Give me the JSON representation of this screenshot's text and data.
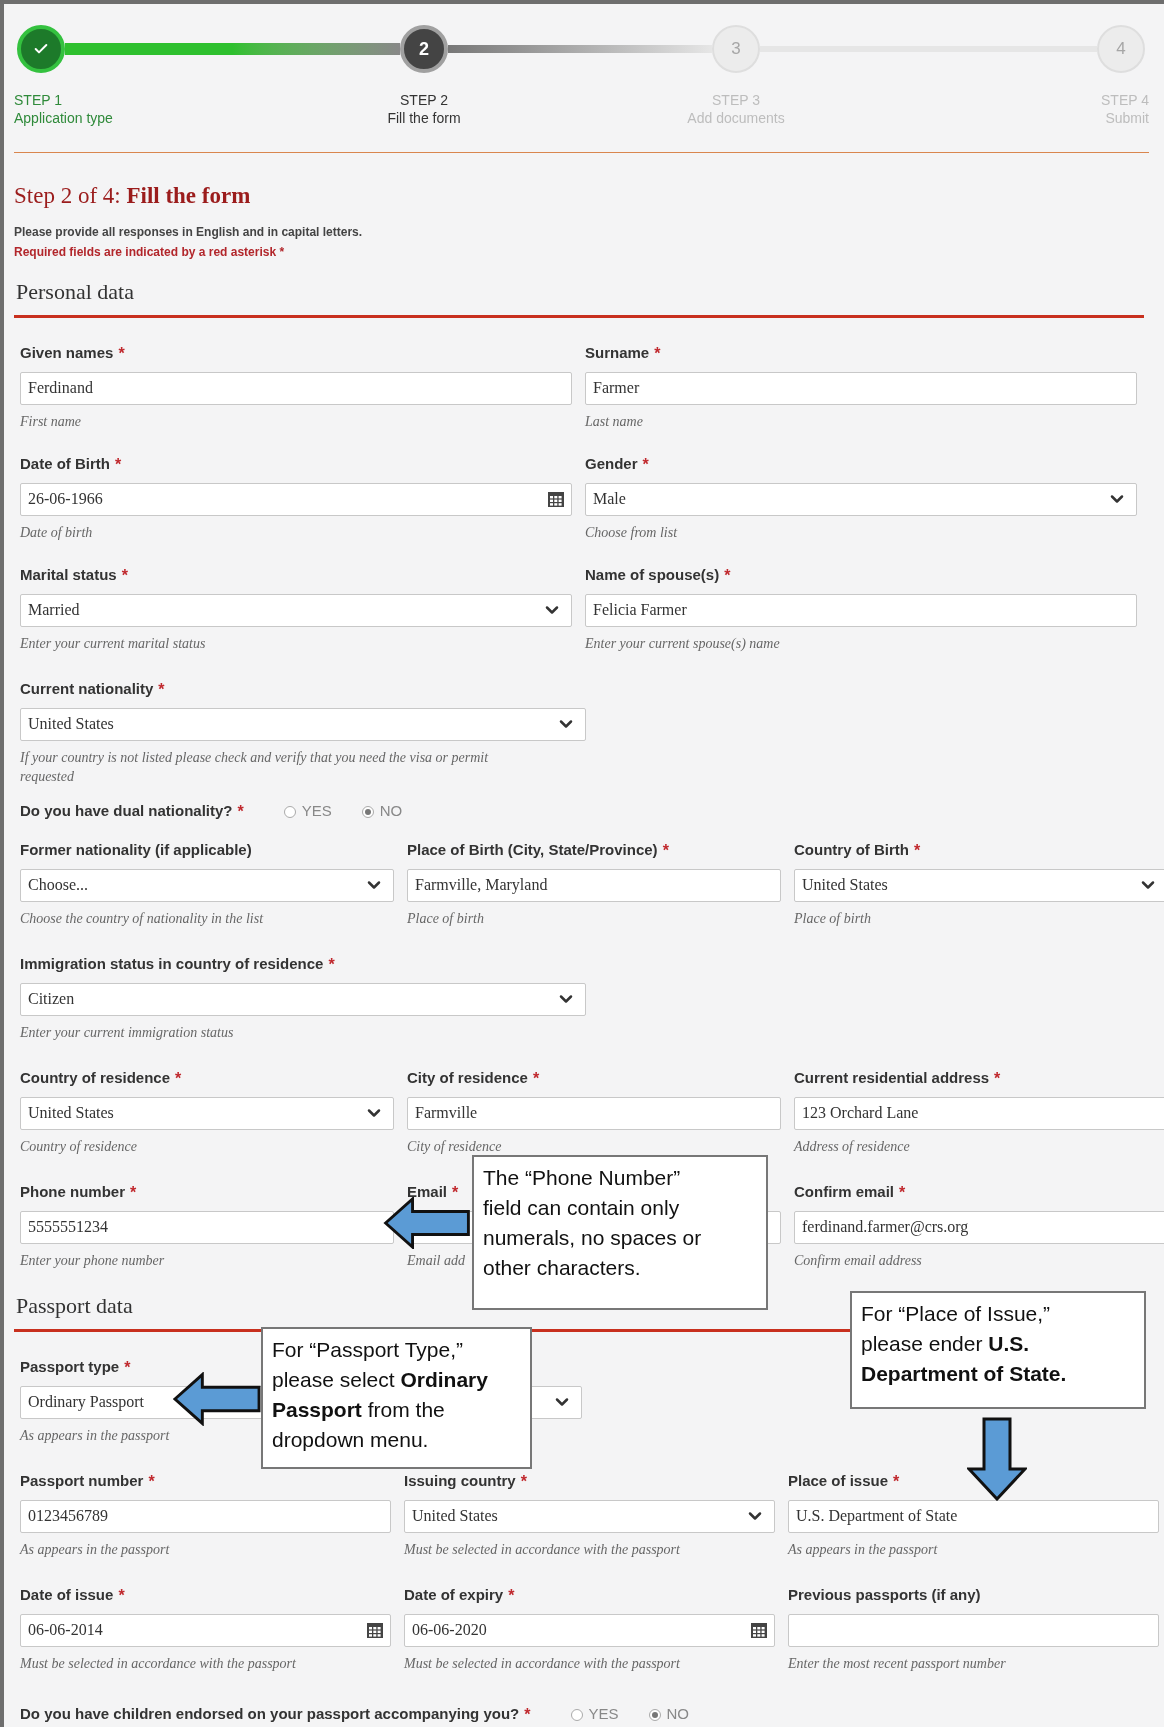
{
  "steps": [
    {
      "completed": true,
      "selected": false,
      "step": "STEP 1",
      "title": "Application type"
    },
    {
      "completed": false,
      "selected": true,
      "number": "2",
      "step": "STEP 2",
      "title": "Fill the form"
    },
    {
      "completed": false,
      "selected": false,
      "number": "3",
      "step": "STEP 3",
      "title": "Add documents"
    },
    {
      "completed": false,
      "selected": false,
      "number": "4",
      "step": "STEP 4",
      "title": "Submit"
    }
  ],
  "heading": "Step 2 of 4: **Fill the form**",
  "instructions": "Please provide all responses in English and in capital letters.",
  "required_note": "Required fields are indicated by a red asterisk *",
  "sections": [
    {
      "title": "Personal data",
      "blocks": [
        {
          "kind": "pair",
          "fields": [
            {
              "label": "Given names",
              "asterisk": "*",
              "kind": "text",
              "value": "Ferdinand",
              "hint": "First name"
            },
            {
              "label": "Surname",
              "asterisk": "*",
              "kind": "text",
              "value": "Farmer",
              "hint": "Last name"
            }
          ]
        },
        {
          "kind": "pair",
          "fields": [
            {
              "label": "Date of Birth",
              "asterisk": "*",
              "kind": "date",
              "value": "26-06-1966",
              "hint": "Date of birth"
            },
            {
              "label": "Gender",
              "asterisk": "*",
              "kind": "select",
              "value": "Male",
              "hint": "Choose from list"
            }
          ]
        },
        {
          "kind": "pair",
          "fields": [
            {
              "label": "Marital status",
              "asterisk": "*",
              "kind": "select",
              "value": "Married",
              "hint": "Enter your current marital status"
            },
            {
              "label": "Name of spouse(s)",
              "asterisk": "*",
              "kind": "text",
              "value": "Felicia Farmer",
              "hint": "Enter your current spouse(s) name"
            }
          ]
        },
        {
          "kind": "single",
          "fields": [
            {
              "label": "Current nationality",
              "asterisk": "*",
              "kind": "select",
              "value": "United States",
              "hint": "If your country is not listed please check and verify that you need the visa or permit requested"
            }
          ]
        },
        {
          "kind": "question",
          "question": "Do you have dual nationality?",
          "asterisk": "*",
          "options": [
            {
              "label": "YES",
              "selected": false
            },
            {
              "label": "NO",
              "selected": true
            }
          ]
        },
        {
          "kind": "triple",
          "fields": [
            {
              "label": "Former nationality (if applicable)",
              "kind": "select",
              "value": "Choose...",
              "hint": "Choose the country of nationality in the list"
            },
            {
              "label": "Place of Birth (City, State/Province)",
              "asterisk": "*",
              "kind": "text",
              "value": "Farmville, Maryland",
              "hint": "Place of birth"
            },
            {
              "label": "Country of Birth",
              "asterisk": "*",
              "kind": "select",
              "value": "United States",
              "hint": "Place of birth"
            }
          ]
        },
        {
          "kind": "single",
          "fields": [
            {
              "label": "Immigration status in country of residence",
              "asterisk": "*",
              "kind": "select",
              "value": "Citizen",
              "hint": "Enter your current immigration status"
            }
          ]
        },
        {
          "kind": "triple",
          "fields": [
            {
              "label": "Country of residence",
              "asterisk": "*",
              "kind": "select",
              "value": "United States",
              "hint": "Country of residence"
            },
            {
              "label": "City of residence",
              "asterisk": "*",
              "kind": "text",
              "value": "Farmville",
              "hint": "City of residence"
            },
            {
              "label": "Current residential address",
              "asterisk": "*",
              "kind": "text",
              "value": "123 Orchard Lane",
              "hint": "Address of residence"
            }
          ]
        },
        {
          "kind": "triple",
          "fields": [
            {
              "label": "Phone number",
              "asterisk": "*",
              "kind": "text",
              "value": "5555551234",
              "hint": "Enter your phone number"
            },
            {
              "label": "Email",
              "asterisk": "*",
              "kind": "text",
              "hint": "Email add"
            },
            {
              "label": "Confirm email",
              "asterisk": "*",
              "kind": "text",
              "value": "ferdinand.farmer@crs.org",
              "hint": "Confirm email address"
            }
          ]
        }
      ]
    },
    {
      "title": "Passport data",
      "blocks": [
        {
          "kind": "single",
          "fields": [
            {
              "label": "Passport type",
              "asterisk": "*",
              "kind": "select",
              "value": "Ordinary Passport",
              "hint": "As appears in the passport"
            }
          ]
        },
        {
          "kind": "triple",
          "fields": [
            {
              "label": "Passport number",
              "asterisk": "*",
              "kind": "text",
              "value": "0123456789",
              "hint": "As appears in the passport"
            },
            {
              "label": "Issuing country",
              "asterisk": "*",
              "kind": "select",
              "value": "United States",
              "hint": "Must be selected in accordance with the passport"
            },
            {
              "label": "Place of issue",
              "asterisk": "*",
              "kind": "text",
              "value": "U.S. Department of State",
              "hint": "As appears in the passport"
            }
          ]
        },
        {
          "kind": "triple",
          "fields": [
            {
              "label": "Date of issue",
              "asterisk": "*",
              "kind": "date",
              "value": "06-06-2014",
              "hint": "Must be selected in accordance with the passport"
            },
            {
              "label": "Date of expiry",
              "asterisk": "*",
              "kind": "date",
              "value": "06-06-2020",
              "hint": "Must be selected in accordance with the passport"
            },
            {
              "label": "Previous passports (if any)",
              "kind": "text",
              "hint": "Enter the most recent passport number"
            }
          ]
        },
        {
          "kind": "question",
          "question": "Do you have children endorsed on your passport accompanying you?",
          "asterisk": "*",
          "options": [
            {
              "label": "YES",
              "selected": false
            },
            {
              "label": "NO",
              "selected": true
            }
          ]
        }
      ]
    }
  ],
  "callouts": [
    {
      "text": "The “Phone Number” field can contain only numerals, no spaces or other characters.",
      "kind": "left"
    },
    {
      "text": "For “Passport Type,” please select **Ordinary Passport** from the dropdown menu.",
      "kind": "left"
    },
    {
      "text": "For “Place of Issue,” please ender **U.S. Department of State.**",
      "kind": "down"
    }
  ]
}
